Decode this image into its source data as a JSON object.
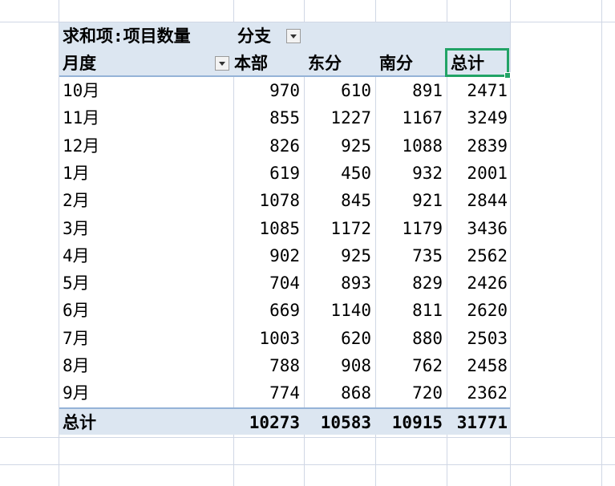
{
  "pivot": {
    "filter_label": "求和项:项目数量",
    "column_field": "分支",
    "row_field": "月度",
    "columns": [
      "本部",
      "东分",
      "南分",
      "总计"
    ],
    "rows": [
      {
        "label": "10月",
        "values": [
          "970",
          "610",
          "891",
          "2471"
        ]
      },
      {
        "label": "11月",
        "values": [
          "855",
          "1227",
          "1167",
          "3249"
        ]
      },
      {
        "label": "12月",
        "values": [
          "826",
          "925",
          "1088",
          "2839"
        ]
      },
      {
        "label": "1月",
        "values": [
          "619",
          "450",
          "932",
          "2001"
        ]
      },
      {
        "label": "2月",
        "values": [
          "1078",
          "845",
          "921",
          "2844"
        ]
      },
      {
        "label": "3月",
        "values": [
          "1085",
          "1172",
          "1179",
          "3436"
        ]
      },
      {
        "label": "4月",
        "values": [
          "902",
          "925",
          "735",
          "2562"
        ]
      },
      {
        "label": "5月",
        "values": [
          "704",
          "893",
          "829",
          "2426"
        ]
      },
      {
        "label": "6月",
        "values": [
          "669",
          "1140",
          "811",
          "2620"
        ]
      },
      {
        "label": "7月",
        "values": [
          "1003",
          "620",
          "880",
          "2503"
        ]
      },
      {
        "label": "8月",
        "values": [
          "788",
          "908",
          "762",
          "2458"
        ]
      },
      {
        "label": "9月",
        "values": [
          "774",
          "868",
          "720",
          "2362"
        ]
      }
    ],
    "total": {
      "label": "总计",
      "values": [
        "10273",
        "10583",
        "10915",
        "31771"
      ]
    }
  },
  "colors": {
    "header_bg": "#dce6f1",
    "header_border": "#95b3d7",
    "selection": "#21a366",
    "gridline": "#d0d7e5"
  }
}
